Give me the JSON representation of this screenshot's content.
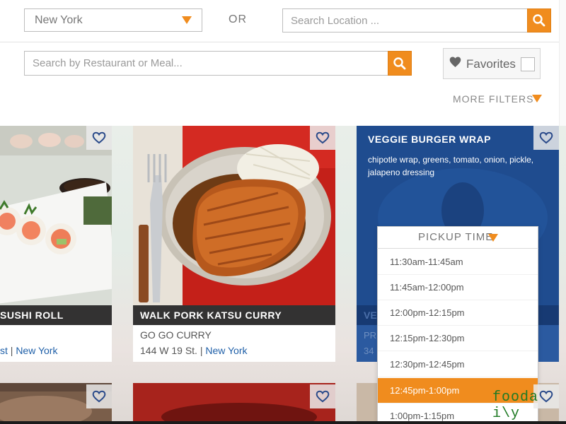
{
  "header": {
    "city_select": {
      "value": "New York"
    },
    "or_label": "OR",
    "location_search": {
      "placeholder": "Search Location ..."
    },
    "meal_search": {
      "placeholder": "Search by Restaurant or Meal..."
    },
    "favorites": {
      "label": "Favorites",
      "checked": false
    },
    "more_filters_label": "MORE FILTERS"
  },
  "cards": [
    {
      "name": "SUSHI ROLL",
      "address_partial": "st",
      "city": "New York"
    },
    {
      "name": "WALK PORK KATSU CURRY",
      "restaurant": "GO GO CURRY",
      "address": "144 W 19 St.",
      "city": "New York"
    },
    {
      "name": "VEGGIE BURGER WRAP",
      "description": "chipotle wrap, greens, tomato, onion, pickle, jalapeno dressing",
      "hidden_name_partial": "VE",
      "hidden_line1_partial": "PR",
      "hidden_line2_partial": "34"
    }
  ],
  "pickup": {
    "label": "PICKUP TIME",
    "options": [
      {
        "label": "11:30am-11:45am"
      },
      {
        "label": "11:45am-12:00pm"
      },
      {
        "label": "12:00pm-12:15pm"
      },
      {
        "label": "12:15pm-12:30pm"
      },
      {
        "label": "12:30pm-12:45pm"
      },
      {
        "label": "12:45pm-1:00pm"
      },
      {
        "label": "1:00pm-1:15pm"
      }
    ],
    "selected_index": 5
  },
  "watermark": "fooda i\\y",
  "colors": {
    "accent": "#f08c1e",
    "heart": "#2a4a8a",
    "veggie_card": "#1f4c8f",
    "address_link": "#1e5fa8"
  },
  "icons": {
    "search": "search-icon",
    "heart": "heart-icon",
    "caret": "caret-down-icon"
  }
}
